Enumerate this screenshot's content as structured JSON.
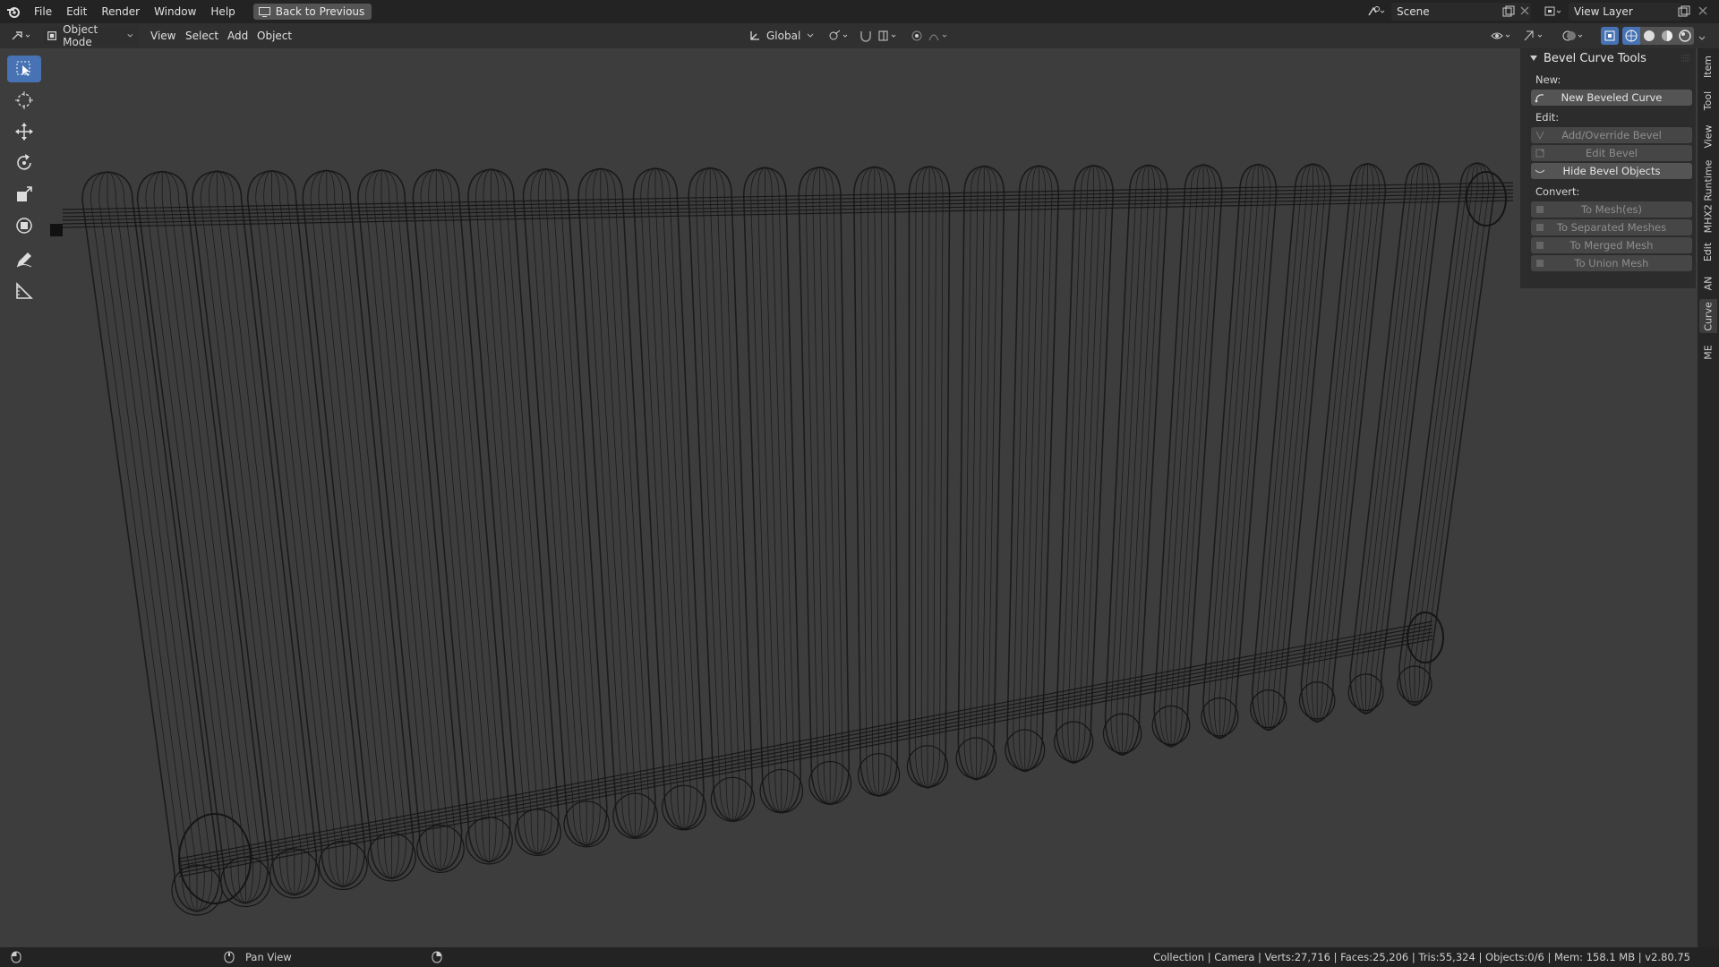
{
  "topbar": {
    "menus": [
      "File",
      "Edit",
      "Render",
      "Window",
      "Help"
    ],
    "back_button": "Back to Previous",
    "scene": "Scene",
    "view_layer": "View Layer"
  },
  "header": {
    "mode": "Object Mode",
    "menus": [
      "View",
      "Select",
      "Add",
      "Object"
    ],
    "transform_orientation": "Global"
  },
  "tools": [
    "select-box-tool",
    "cursor-tool",
    "move-tool",
    "rotate-tool",
    "scale-tool",
    "transform-tool",
    "annotate-tool",
    "measure-tool"
  ],
  "panel": {
    "title": "Bevel Curve Tools",
    "new_label": "New:",
    "new_beveled_curve": "New Beveled Curve",
    "edit_label": "Edit:",
    "add_override_bevel": "Add/Override Bevel",
    "edit_bevel": "Edit Bevel",
    "hide_bevel_objects": "Hide Bevel Objects",
    "convert_label": "Convert:",
    "to_meshes": "To Mesh(es)",
    "to_separated_meshes": "To Separated Meshes",
    "to_merged_mesh": "To Merged Mesh",
    "to_union_mesh": "To Union Mesh"
  },
  "sidebar_tabs": [
    "Item",
    "Tool",
    "View",
    "MHX2 Runtime",
    "Edit",
    "AN",
    "Curve",
    "ME"
  ],
  "status": {
    "action": "Pan View",
    "info": "Collection | Camera | Verts:27,716 | Faces:25,206 | Tris:55,324 | Objects:0/6 | Mem: 158.1 MB | v2.80.75"
  },
  "colors": {
    "active_tool": "#4772b3",
    "viewport_bg": "#3d3d3d",
    "wire": "#151515"
  }
}
